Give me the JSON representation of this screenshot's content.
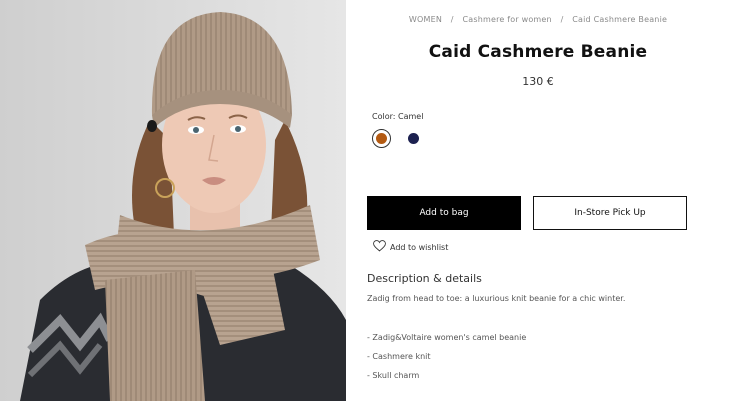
{
  "breadcrumb": {
    "items": [
      "WOMEN",
      "Cashmere for women",
      "Caid Cashmere Beanie"
    ],
    "separator": "/"
  },
  "product": {
    "title": "Caid Cashmere Beanie",
    "price": "130 €"
  },
  "color": {
    "label": "Color: Camel",
    "swatches": [
      {
        "name": "camel",
        "hex": "#b35a12",
        "selected": true
      },
      {
        "name": "navy",
        "hex": "#1c2150",
        "selected": false
      }
    ]
  },
  "actions": {
    "add_to_bag": "Add to bag",
    "in_store_pickup": "In-Store Pick Up",
    "wishlist": "Add to wishlist"
  },
  "description": {
    "heading": "Description & details",
    "text": "Zadig from head to toe: a luxurious knit beanie for a chic winter.",
    "bullets": [
      "- Zadig&Voltaire women's camel beanie",
      "- Cashmere knit",
      "- Skull charm"
    ]
  },
  "icons": {
    "wishlist": "heart-outline-icon"
  }
}
